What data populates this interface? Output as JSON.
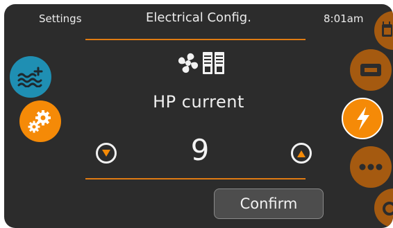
{
  "header": {
    "back_label": "Settings",
    "title": "Electrical Config.",
    "time": "8:01am"
  },
  "parameter": {
    "label": "HP current",
    "value": "9",
    "icon": "fan-heat-pump-icon"
  },
  "buttons": {
    "confirm_label": "Confirm"
  },
  "left_nav": [
    {
      "icon": "water-temperature-icon",
      "color": "#1f8fb3"
    },
    {
      "icon": "gears-settings-icon",
      "color": "#f58a07"
    }
  ],
  "right_nav": [
    {
      "icon": "clock-schedule-icon",
      "color": "#a55a10"
    },
    {
      "icon": "display-panel-icon",
      "color": "#a55a10"
    },
    {
      "icon": "lightning-electrical-icon",
      "color": "#f58a07"
    },
    {
      "icon": "more-options-icon",
      "color": "#a55a10"
    },
    {
      "icon": "power-icon",
      "color": "#a55a10"
    }
  ],
  "colors": {
    "accent": "#f58a07",
    "accent_dim": "#a55a10",
    "divider": "#e07b12",
    "background": "#2c2c2c",
    "water_blue": "#1f8fb3"
  }
}
